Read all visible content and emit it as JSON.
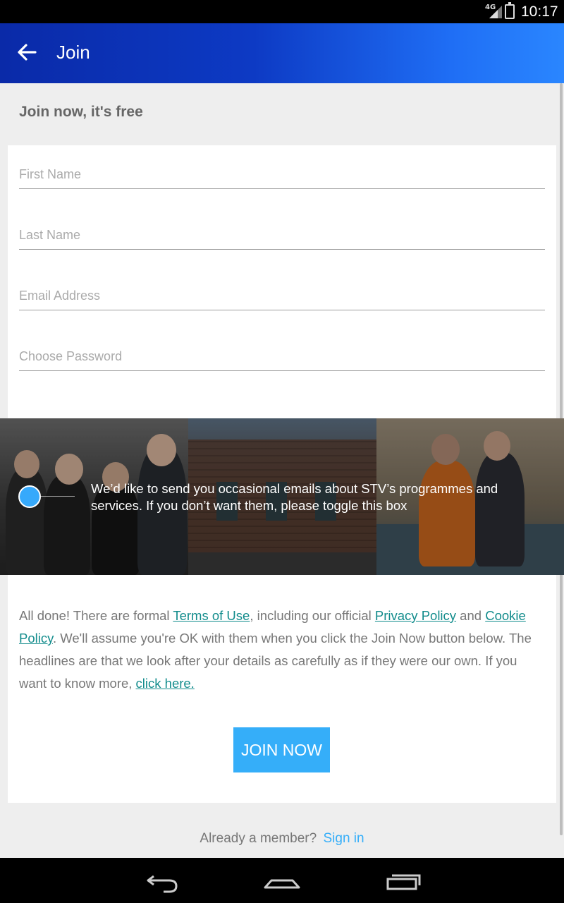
{
  "status_bar": {
    "network": "4G",
    "time": "10:17"
  },
  "app_bar": {
    "title": "Join",
    "back_icon": "arrow-left-icon"
  },
  "form": {
    "heading": "Join now, it's free",
    "fields": [
      {
        "placeholder": "First Name",
        "value": ""
      },
      {
        "placeholder": "Last Name",
        "value": ""
      },
      {
        "placeholder": "Email Address",
        "value": ""
      },
      {
        "placeholder": "Choose Password",
        "value": ""
      }
    ]
  },
  "marketing": {
    "text": "We’d like to send you occasional emails about STV’s programmes and services. If you don’t want them, please toggle this box",
    "toggle_color": "#36a9fb"
  },
  "legal": {
    "part1": "All done! There are formal ",
    "terms_link": "Terms of Use",
    "part2": ", including our official ",
    "privacy_link": "Privacy Policy",
    "part3": " and ",
    "cookie_link": "Cookie Policy",
    "part4": ". We'll assume you're OK with them when you click the Join Now button below. The headlines are that we look after your details as carefully as if they were our own. If you want to know more, ",
    "click_link": "click here.",
    "link_color": "#128c8c"
  },
  "join_button": {
    "label": "JOIN NOW",
    "color": "#35aef9"
  },
  "signin": {
    "prompt": "Already a member?",
    "link": "Sign in"
  },
  "nav_bar": {
    "back_icon": "nav-back-icon",
    "home_icon": "nav-home-icon",
    "recents_icon": "nav-recents-icon"
  }
}
